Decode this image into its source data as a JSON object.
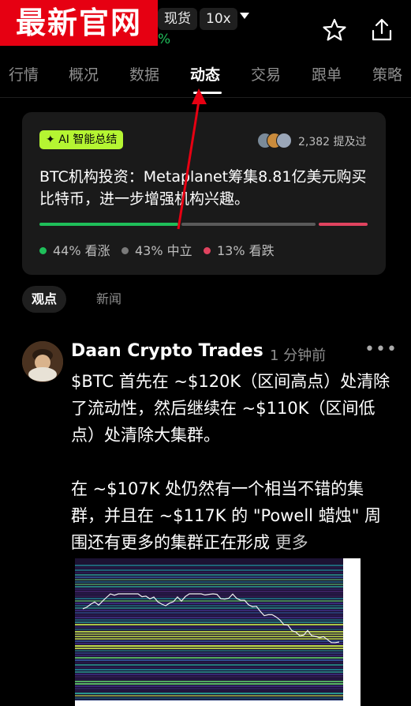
{
  "watermark": {
    "text": "最新官网"
  },
  "header": {
    "market_type": "现货",
    "leverage": "10x",
    "change_suffix": "%",
    "star_icon": "star-icon",
    "share_icon": "share-icon"
  },
  "tabs": [
    {
      "label": "行情"
    },
    {
      "label": "概况"
    },
    {
      "label": "数据"
    },
    {
      "label": "动态",
      "active": true
    },
    {
      "label": "交易"
    },
    {
      "label": "跟单"
    },
    {
      "label": "策略"
    }
  ],
  "ai_card": {
    "badge": "AI 智能总结",
    "mentions": "2,382 提及过",
    "summary": "BTC机构投资：Metaplanet筹集8.81亿美元购买比特币，进一步增强机构兴趣。",
    "sentiment": [
      {
        "label": "44% 看涨",
        "value": 44,
        "color": "#1fbf5a"
      },
      {
        "label": "43% 中立",
        "value": 43,
        "color": "#5a5a5a"
      },
      {
        "label": "13% 看跌",
        "value": 13,
        "color": "#e0435f"
      }
    ]
  },
  "subtabs": {
    "active": "观点",
    "other": "新闻"
  },
  "post": {
    "author": "Daan Crypto Trades",
    "time": "1 分钟前",
    "paragraph1": "$BTC 首先在 ~$120K（区间高点）处清除了流动性，然后继续在 ~$110K（区间低点）处清除大集群。",
    "paragraph2": "在 ~$107K 处仍然有一个相当不错的集群，并且在 ~$117K 的 \"Powell 蜡烛\" 周围还有更多的集群正在形成",
    "more": "更多"
  },
  "colors": {
    "accent_green": "#1fbf5a",
    "badge_green": "#b5f532",
    "bear_red": "#e0435f",
    "brand_red": "#e60012"
  }
}
